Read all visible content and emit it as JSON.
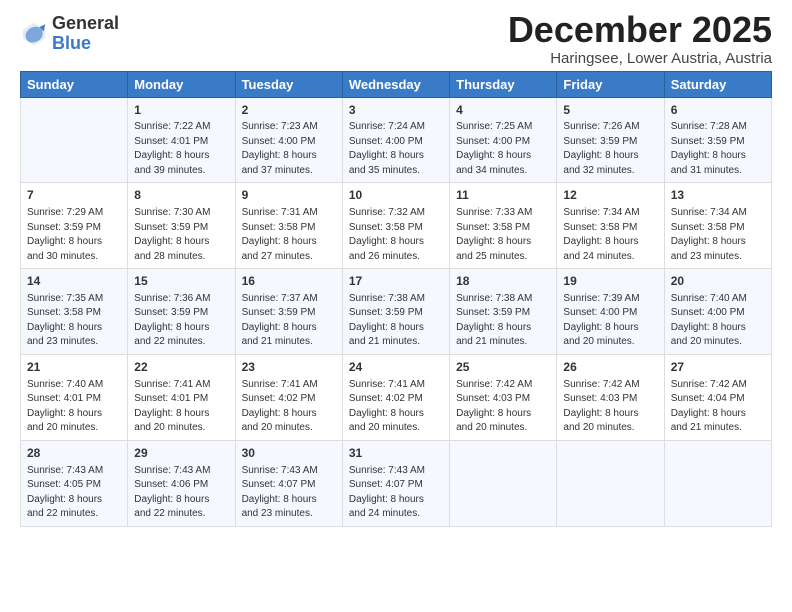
{
  "header": {
    "month_title": "December 2025",
    "location": "Haringsee, Lower Austria, Austria",
    "logo_general": "General",
    "logo_blue": "Blue"
  },
  "days_of_week": [
    "Sunday",
    "Monday",
    "Tuesday",
    "Wednesday",
    "Thursday",
    "Friday",
    "Saturday"
  ],
  "weeks": [
    [
      {
        "day": "",
        "sunrise": "",
        "sunset": "",
        "daylight": ""
      },
      {
        "day": "1",
        "sunrise": "Sunrise: 7:22 AM",
        "sunset": "Sunset: 4:01 PM",
        "daylight": "Daylight: 8 hours and 39 minutes."
      },
      {
        "day": "2",
        "sunrise": "Sunrise: 7:23 AM",
        "sunset": "Sunset: 4:00 PM",
        "daylight": "Daylight: 8 hours and 37 minutes."
      },
      {
        "day": "3",
        "sunrise": "Sunrise: 7:24 AM",
        "sunset": "Sunset: 4:00 PM",
        "daylight": "Daylight: 8 hours and 35 minutes."
      },
      {
        "day": "4",
        "sunrise": "Sunrise: 7:25 AM",
        "sunset": "Sunset: 4:00 PM",
        "daylight": "Daylight: 8 hours and 34 minutes."
      },
      {
        "day": "5",
        "sunrise": "Sunrise: 7:26 AM",
        "sunset": "Sunset: 3:59 PM",
        "daylight": "Daylight: 8 hours and 32 minutes."
      },
      {
        "day": "6",
        "sunrise": "Sunrise: 7:28 AM",
        "sunset": "Sunset: 3:59 PM",
        "daylight": "Daylight: 8 hours and 31 minutes."
      }
    ],
    [
      {
        "day": "7",
        "sunrise": "Sunrise: 7:29 AM",
        "sunset": "Sunset: 3:59 PM",
        "daylight": "Daylight: 8 hours and 30 minutes."
      },
      {
        "day": "8",
        "sunrise": "Sunrise: 7:30 AM",
        "sunset": "Sunset: 3:59 PM",
        "daylight": "Daylight: 8 hours and 28 minutes."
      },
      {
        "day": "9",
        "sunrise": "Sunrise: 7:31 AM",
        "sunset": "Sunset: 3:58 PM",
        "daylight": "Daylight: 8 hours and 27 minutes."
      },
      {
        "day": "10",
        "sunrise": "Sunrise: 7:32 AM",
        "sunset": "Sunset: 3:58 PM",
        "daylight": "Daylight: 8 hours and 26 minutes."
      },
      {
        "day": "11",
        "sunrise": "Sunrise: 7:33 AM",
        "sunset": "Sunset: 3:58 PM",
        "daylight": "Daylight: 8 hours and 25 minutes."
      },
      {
        "day": "12",
        "sunrise": "Sunrise: 7:34 AM",
        "sunset": "Sunset: 3:58 PM",
        "daylight": "Daylight: 8 hours and 24 minutes."
      },
      {
        "day": "13",
        "sunrise": "Sunrise: 7:34 AM",
        "sunset": "Sunset: 3:58 PM",
        "daylight": "Daylight: 8 hours and 23 minutes."
      }
    ],
    [
      {
        "day": "14",
        "sunrise": "Sunrise: 7:35 AM",
        "sunset": "Sunset: 3:58 PM",
        "daylight": "Daylight: 8 hours and 23 minutes."
      },
      {
        "day": "15",
        "sunrise": "Sunrise: 7:36 AM",
        "sunset": "Sunset: 3:59 PM",
        "daylight": "Daylight: 8 hours and 22 minutes."
      },
      {
        "day": "16",
        "sunrise": "Sunrise: 7:37 AM",
        "sunset": "Sunset: 3:59 PM",
        "daylight": "Daylight: 8 hours and 21 minutes."
      },
      {
        "day": "17",
        "sunrise": "Sunrise: 7:38 AM",
        "sunset": "Sunset: 3:59 PM",
        "daylight": "Daylight: 8 hours and 21 minutes."
      },
      {
        "day": "18",
        "sunrise": "Sunrise: 7:38 AM",
        "sunset": "Sunset: 3:59 PM",
        "daylight": "Daylight: 8 hours and 21 minutes."
      },
      {
        "day": "19",
        "sunrise": "Sunrise: 7:39 AM",
        "sunset": "Sunset: 4:00 PM",
        "daylight": "Daylight: 8 hours and 20 minutes."
      },
      {
        "day": "20",
        "sunrise": "Sunrise: 7:40 AM",
        "sunset": "Sunset: 4:00 PM",
        "daylight": "Daylight: 8 hours and 20 minutes."
      }
    ],
    [
      {
        "day": "21",
        "sunrise": "Sunrise: 7:40 AM",
        "sunset": "Sunset: 4:01 PM",
        "daylight": "Daylight: 8 hours and 20 minutes."
      },
      {
        "day": "22",
        "sunrise": "Sunrise: 7:41 AM",
        "sunset": "Sunset: 4:01 PM",
        "daylight": "Daylight: 8 hours and 20 minutes."
      },
      {
        "day": "23",
        "sunrise": "Sunrise: 7:41 AM",
        "sunset": "Sunset: 4:02 PM",
        "daylight": "Daylight: 8 hours and 20 minutes."
      },
      {
        "day": "24",
        "sunrise": "Sunrise: 7:41 AM",
        "sunset": "Sunset: 4:02 PM",
        "daylight": "Daylight: 8 hours and 20 minutes."
      },
      {
        "day": "25",
        "sunrise": "Sunrise: 7:42 AM",
        "sunset": "Sunset: 4:03 PM",
        "daylight": "Daylight: 8 hours and 20 minutes."
      },
      {
        "day": "26",
        "sunrise": "Sunrise: 7:42 AM",
        "sunset": "Sunset: 4:03 PM",
        "daylight": "Daylight: 8 hours and 20 minutes."
      },
      {
        "day": "27",
        "sunrise": "Sunrise: 7:42 AM",
        "sunset": "Sunset: 4:04 PM",
        "daylight": "Daylight: 8 hours and 21 minutes."
      }
    ],
    [
      {
        "day": "28",
        "sunrise": "Sunrise: 7:43 AM",
        "sunset": "Sunset: 4:05 PM",
        "daylight": "Daylight: 8 hours and 22 minutes."
      },
      {
        "day": "29",
        "sunrise": "Sunrise: 7:43 AM",
        "sunset": "Sunset: 4:06 PM",
        "daylight": "Daylight: 8 hours and 22 minutes."
      },
      {
        "day": "30",
        "sunrise": "Sunrise: 7:43 AM",
        "sunset": "Sunset: 4:07 PM",
        "daylight": "Daylight: 8 hours and 23 minutes."
      },
      {
        "day": "31",
        "sunrise": "Sunrise: 7:43 AM",
        "sunset": "Sunset: 4:07 PM",
        "daylight": "Daylight: 8 hours and 24 minutes."
      },
      {
        "day": "",
        "sunrise": "",
        "sunset": "",
        "daylight": ""
      },
      {
        "day": "",
        "sunrise": "",
        "sunset": "",
        "daylight": ""
      },
      {
        "day": "",
        "sunrise": "",
        "sunset": "",
        "daylight": ""
      }
    ]
  ]
}
